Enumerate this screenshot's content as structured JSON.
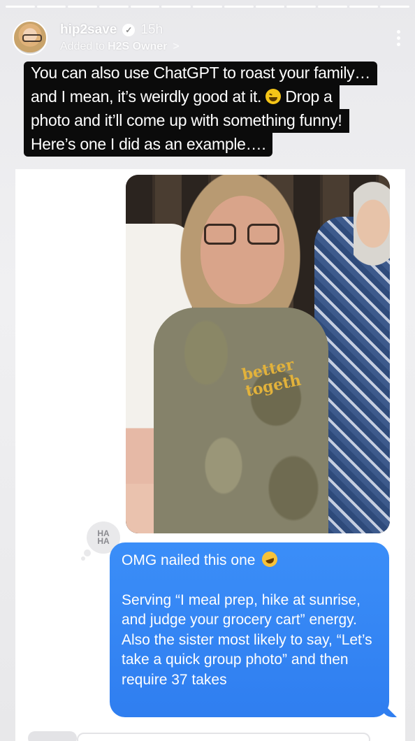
{
  "story": {
    "username": "hip2save",
    "time": "15h",
    "added_prefix": "Added to",
    "added_collection": "H2S Owner",
    "more_icon": "more-vertical-icon",
    "progress_segments": 13,
    "progress_done": 13
  },
  "caption": {
    "lines": [
      "You can also use ChatGPT to roast your family…",
      "and I mean, it’s weirdly good at it.",
      "Drop a",
      "photo and it’ll come up with something funny!",
      "Here’s one I did as an example…."
    ],
    "emoji": "laughing-squint-emoji"
  },
  "photo": {
    "shirt_text_1": "better",
    "shirt_text_2": "togeth"
  },
  "tapback": {
    "line1": "HA",
    "line2": "HA"
  },
  "message": {
    "line1": "OMG nailed this one",
    "emoji": "rolling-laughing-emoji",
    "body": "Serving “I meal prep, hike at sunrise, and judge your grocery cart” energy. Also the sister most likely to say, “Let’s take a quick group photo” and then require 37 takes",
    "color": "#3b8ef8"
  }
}
